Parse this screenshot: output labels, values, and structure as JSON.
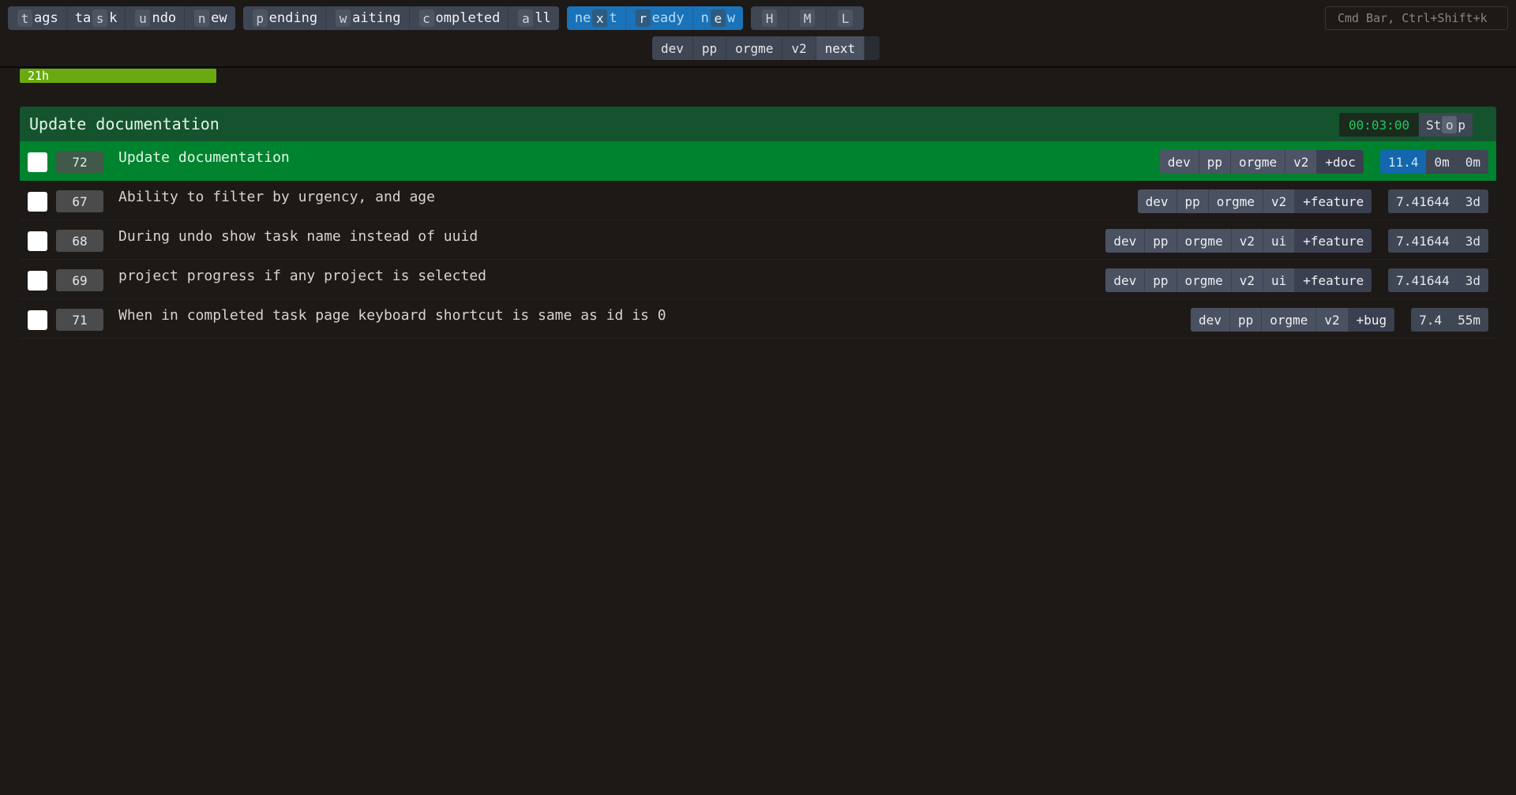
{
  "topbar": {
    "group1": [
      {
        "pre": "",
        "key": "t",
        "post": "ags"
      },
      {
        "pre": "ta",
        "key": "s",
        "post": "k"
      },
      {
        "pre": "",
        "key": "u",
        "post": "ndo"
      },
      {
        "pre": "",
        "key": "n",
        "post": "ew"
      }
    ],
    "group2": [
      {
        "pre": "",
        "key": "p",
        "post": "ending"
      },
      {
        "pre": "",
        "key": "w",
        "post": "aiting"
      },
      {
        "pre": "",
        "key": "c",
        "post": "ompleted"
      },
      {
        "pre": "",
        "key": "a",
        "post": "ll"
      }
    ],
    "group3": [
      {
        "pre": "ne",
        "key": "x",
        "post": "t"
      },
      {
        "pre": "",
        "key": "r",
        "post": "eady"
      },
      {
        "pre": "n",
        "key": "e",
        "post": "w"
      }
    ],
    "priority": [
      "H",
      "M",
      "L"
    ],
    "cmd_bar": "Cmd Bar, Ctrl+Shift+k"
  },
  "context_tags": [
    "dev",
    "pp",
    "orgme",
    "v2",
    "next"
  ],
  "progress": {
    "label": "21h",
    "fraction": 1.0,
    "color": "#6aaa10"
  },
  "active_task": {
    "title": "Update documentation",
    "timer": "00:03:00",
    "stop": {
      "pre": "St",
      "key": "o",
      "post": "p"
    }
  },
  "tasks": [
    {
      "id": "72",
      "description": "Update documentation",
      "tags": [
        "dev",
        "pp",
        "orgme",
        "v2"
      ],
      "project": "+doc",
      "urgency": "11.4",
      "meta": [
        "0m",
        "0m"
      ],
      "active": true
    },
    {
      "id": "67",
      "description": "Ability to filter by urgency, and age",
      "tags": [
        "dev",
        "pp",
        "orgme",
        "v2"
      ],
      "project": "+feature",
      "urgency": "7.41644",
      "meta": [
        "3d"
      ],
      "active": false
    },
    {
      "id": "68",
      "description": "During undo show task name instead of uuid",
      "tags": [
        "dev",
        "pp",
        "orgme",
        "v2",
        "ui"
      ],
      "project": "+feature",
      "urgency": "7.41644",
      "meta": [
        "3d"
      ],
      "active": false
    },
    {
      "id": "69",
      "description": "project progress if any project is selected",
      "tags": [
        "dev",
        "pp",
        "orgme",
        "v2",
        "ui"
      ],
      "project": "+feature",
      "urgency": "7.41644",
      "meta": [
        "3d"
      ],
      "active": false
    },
    {
      "id": "71",
      "description": "When in completed task page keyboard shortcut is same as id is 0",
      "tags": [
        "dev",
        "pp",
        "orgme",
        "v2"
      ],
      "project": "+bug",
      "urgency": "7.4",
      "meta": [
        "55m"
      ],
      "active": false
    }
  ],
  "colors": {
    "background": "#1c1917",
    "active_row": "#00832f",
    "active_header": "#14532d",
    "accent_blue": "#1a72b8",
    "timer_green": "#22c55e"
  }
}
